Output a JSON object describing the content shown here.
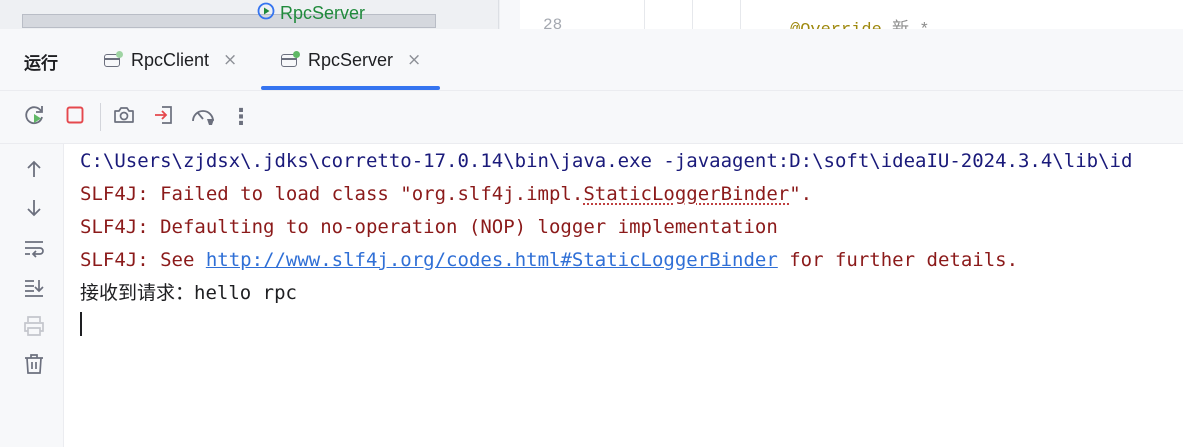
{
  "editor_strip": {
    "run_config_label": "RpcServer",
    "line_number": "28",
    "code_annotation": "@Override",
    "code_hint": "新 *"
  },
  "run_panel": {
    "title": "运行",
    "tabs": [
      {
        "label": "RpcClient",
        "active": false
      },
      {
        "label": "RpcServer",
        "active": true
      }
    ],
    "close_glyph": "×",
    "more_glyph": "⋮"
  },
  "console": {
    "command_line": "C:\\Users\\zjdsx\\.jdks\\corretto-17.0.14\\bin\\java.exe -javaagent:D:\\soft\\ideaIU-2024.3.4\\lib\\id",
    "slf4j_line1_prefix": "SLF4J: Failed to load class \"org.slf4j.impl.",
    "slf4j_line1_class": "StaticLoggerBinder",
    "slf4j_line1_suffix": "\".",
    "slf4j_line2": "SLF4J: Defaulting to no-operation (NOP) logger implementation",
    "slf4j_line3_prefix": "SLF4J: See ",
    "slf4j_line3_link": "http://www.slf4j.org/codes.html#StaticLoggerBinder",
    "slf4j_line3_suffix": " for further details.",
    "output_label": "接收到请求：",
    "output_value": "hello rpc"
  },
  "colors": {
    "accent": "#3574f0",
    "error_text": "#8b1a1a",
    "command_text": "#1a1a7a",
    "link": "#2f6fd6",
    "stop_red": "#e5484d",
    "running_green": "#5fb865"
  }
}
